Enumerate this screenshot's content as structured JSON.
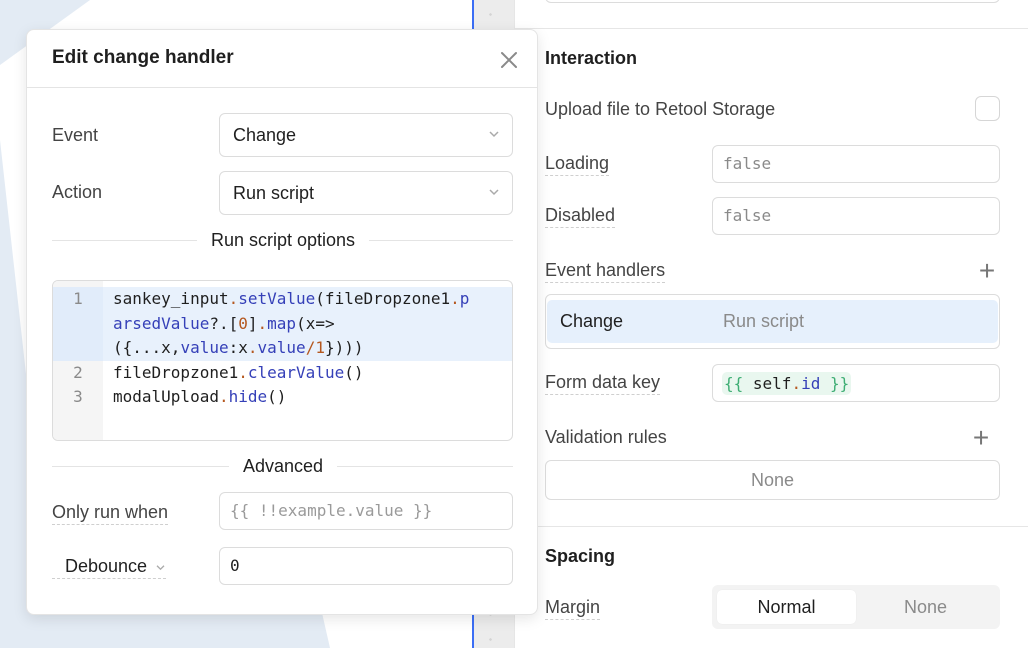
{
  "modal": {
    "title": "Edit change handler",
    "close_icon": "close-icon",
    "event_label": "Event",
    "event_value": "Change",
    "action_label": "Action",
    "action_value": "Run script",
    "options_section_label": "Run script options",
    "code_lines": [
      {
        "number": "1",
        "text": "sankey_input.setValue(fileDropzone1.parsedValue?.[0].map(x=>({...x,value:x.value/1})))"
      },
      {
        "number": "2",
        "text": "fileDropzone1.clearValue()"
      },
      {
        "number": "3",
        "text": "modalUpload.hide()"
      }
    ],
    "advanced_section_label": "Advanced",
    "only_run_when_label": "Only run when",
    "only_run_when_placeholder": "{{ !!example.value }}",
    "debounce_label": "Debounce",
    "debounce_value": "0"
  },
  "inspector": {
    "interaction_title": "Interaction",
    "upload_label": "Upload file to Retool Storage",
    "upload_checked": false,
    "loading_label": "Loading",
    "loading_value": "false",
    "disabled_label": "Disabled",
    "disabled_value": "false",
    "event_handlers_label": "Event handlers",
    "event_handlers": [
      {
        "event": "Change",
        "action": "Run script"
      }
    ],
    "form_data_key_label": "Form data key",
    "form_data_key_value": "{{ self.id }}",
    "validation_rules_label": "Validation rules",
    "validation_rules_empty": "None",
    "spacing_title": "Spacing",
    "margin_label": "Margin",
    "margin_options": [
      "Normal",
      "None"
    ],
    "margin_selected": "Normal"
  },
  "colors": {
    "accent_blue": "#3b6ef5",
    "handler_highlight": "#e6f0fc",
    "code_method": "#3540b8",
    "code_punct": "#b5581f",
    "template_brace": "#3fae74"
  }
}
